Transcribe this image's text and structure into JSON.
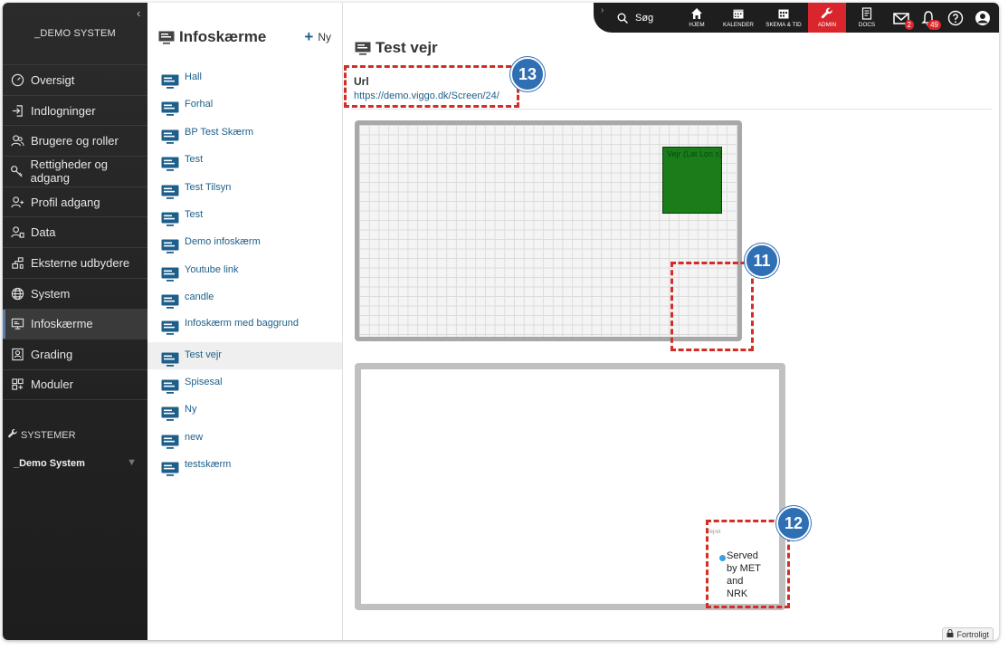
{
  "sidebar": {
    "system_title": "_DEMO SYSTEM",
    "items": [
      {
        "label": "Oversigt",
        "icon": "gauge-icon"
      },
      {
        "label": "Indlogninger",
        "icon": "login-icon"
      },
      {
        "label": "Brugere og roller",
        "icon": "users-icon"
      },
      {
        "label": "Rettigheder og adgang",
        "icon": "key-icon"
      },
      {
        "label": "Profil adgang",
        "icon": "profile-icon"
      },
      {
        "label": "Data",
        "icon": "data-icon"
      },
      {
        "label": "Eksterne udbydere",
        "icon": "network-icon"
      },
      {
        "label": "System",
        "icon": "globe-icon"
      },
      {
        "label": "Infoskærme",
        "icon": "monitor-icon"
      },
      {
        "label": "Grading",
        "icon": "grading-icon"
      },
      {
        "label": "Moduler",
        "icon": "modules-icon"
      }
    ],
    "systems_heading": "SYSTEMER",
    "selected_system": "_Demo System"
  },
  "list": {
    "title": "Infoskærme",
    "new_label": "Ny",
    "items": [
      "Hall",
      "Forhal",
      "BP Test Skærm",
      "Test",
      "Test Tilsyn",
      "Test",
      "Demo infoskærm",
      "Youtube link",
      "candle",
      "Infoskærm med baggrund",
      "Test vejr",
      "Spisesal",
      "Ny",
      "new",
      "testskærm"
    ],
    "selected_index": 10
  },
  "topbar": {
    "search_label": "Søg",
    "items": [
      "HJEM",
      "KALENDER",
      "SKEMA & TID",
      "ADMIN",
      "DOCS"
    ],
    "mail_badge": "2",
    "bell_badge": "49"
  },
  "main": {
    "title": "Test vejr",
    "url_label": "Url",
    "url_value": "https://demo.viggo.dk/Screen/24/",
    "green_widget_text": "Vejr (Lat Lon s)",
    "weather_title": "Vejret",
    "weather_credit": "Served by MET and NRK"
  },
  "callouts": {
    "url": "13",
    "green": "11",
    "weather": "12"
  },
  "footer": {
    "confidential": "Fortroligt"
  },
  "colors": {
    "accent_link": "#1d5f8a",
    "admin_red": "#d9262c",
    "callout_red": "#d32d25",
    "callout_blue": "#2f6fb4",
    "widget_green": "#1a7d1a"
  }
}
